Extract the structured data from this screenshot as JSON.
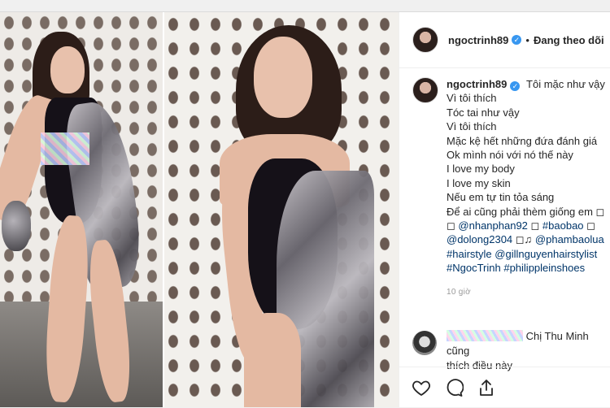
{
  "post": {
    "username": "ngoctrinh89",
    "verified_badge": "✓",
    "follow_status": "Đang theo dõi",
    "separator": "•"
  },
  "caption": {
    "username": "ngoctrinh89",
    "first_line": "Tôi mặc như vậy",
    "lines": [
      "Vì tôi thích",
      "Tóc tai như vậy",
      "Vì tôi thích",
      "Mặc kệ hết những đứa đánh giá",
      "Ok mình nói với nó thế này",
      "I love my body",
      "I love my skin",
      "Nếu em tự tin tỏa sáng",
      "Để ai cũng phải thèm giống em ◻"
    ],
    "tag_lines": [
      [
        "◻ ",
        "@nhanphan92",
        " ◻ ",
        "#baobao",
        " ◻"
      ],
      [
        "@dolong2304",
        " ◻♫ ",
        "@phambaolua"
      ],
      [
        "#hairstyle",
        " ",
        "@gillnguyenhairstylist"
      ],
      [
        "#NgocTrinh",
        " ",
        "#philippleinshoes"
      ]
    ],
    "timestamp": "10 giờ"
  },
  "comment": {
    "text_line1": "Chị Thu Minh cũng",
    "text_line2": "thích điều này"
  },
  "actions": {
    "like_icon": "heart-icon",
    "comment_icon": "comment-icon",
    "share_icon": "share-icon"
  },
  "colors": {
    "link": "#003569",
    "verified": "#3897f0",
    "text": "#262626",
    "muted": "#999999"
  }
}
